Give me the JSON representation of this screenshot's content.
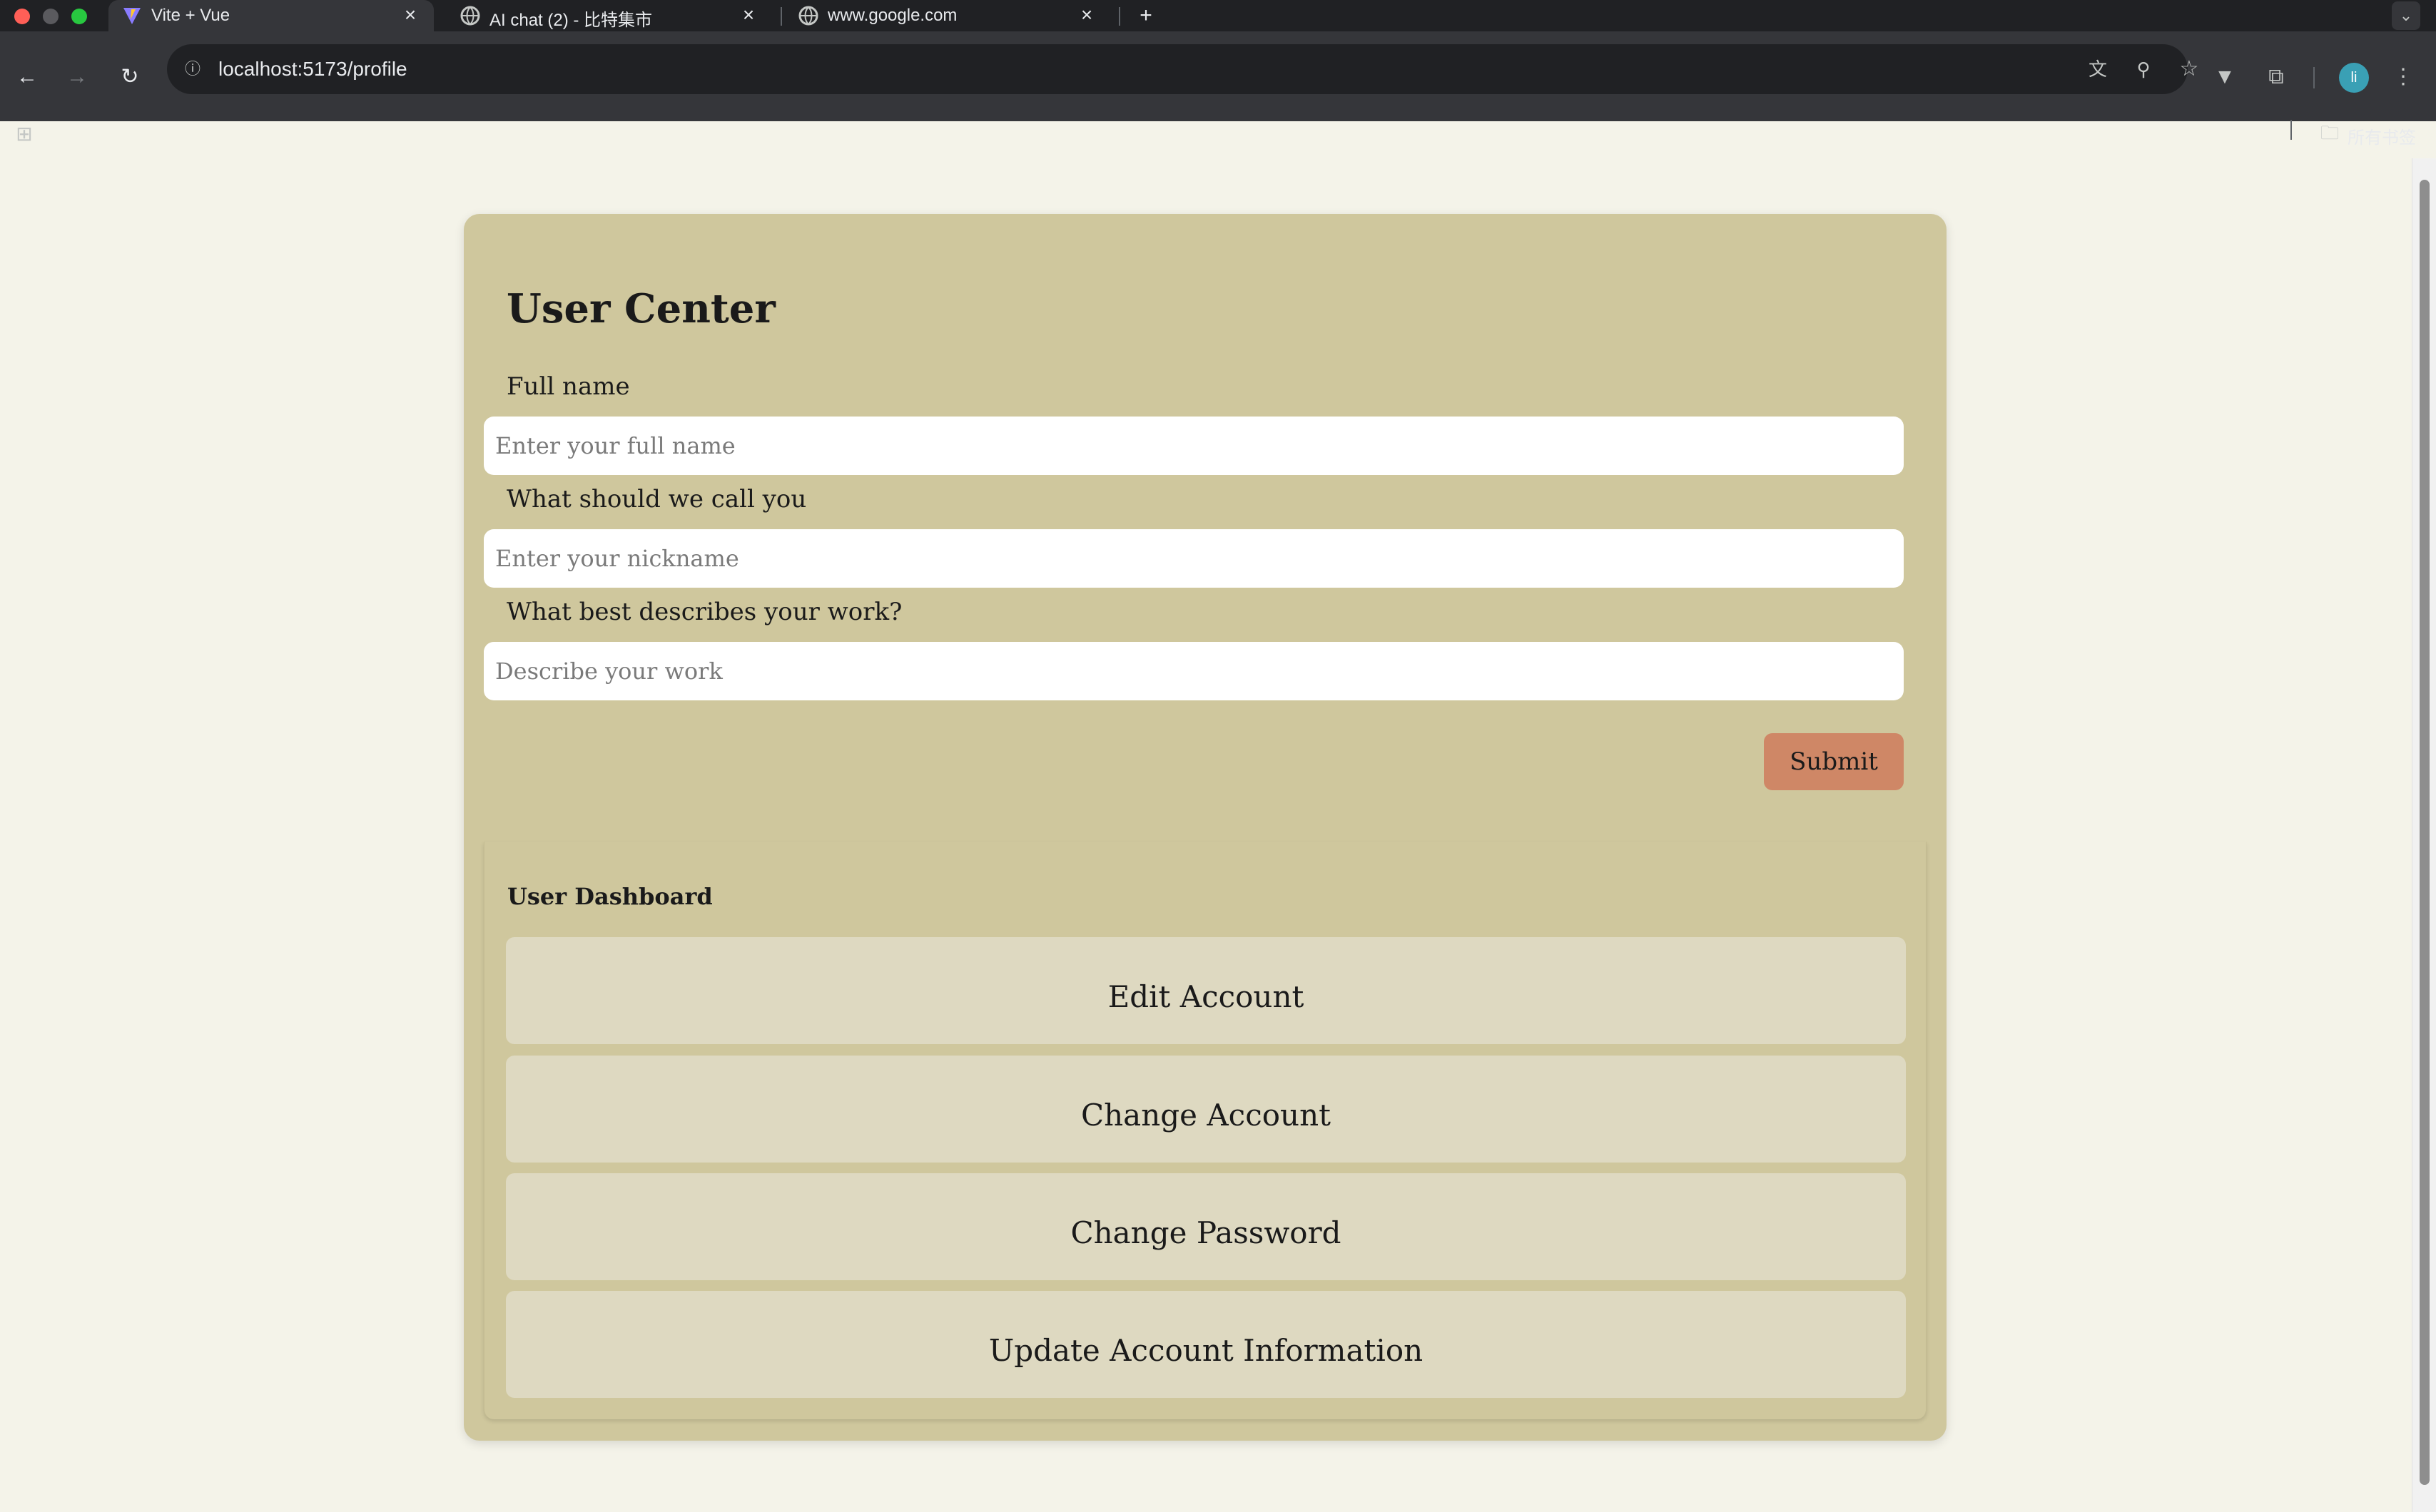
{
  "browser": {
    "tabs": [
      {
        "title": "Vite + Vue",
        "icon": "vite-icon",
        "active": true
      },
      {
        "title": "AI chat (2) - 比特集市",
        "icon": "globe-icon",
        "active": false
      },
      {
        "title": "www.google.com",
        "icon": "globe-icon",
        "active": false
      }
    ],
    "new_tab_symbol": "+",
    "url": "localhost:5173/profile",
    "profile_initial": "li",
    "bookmarks_folder": "所有书签"
  },
  "page": {
    "title": "User Center",
    "fields": [
      {
        "label": "Full name",
        "placeholder": "Enter your full name",
        "value": ""
      },
      {
        "label": "What should we call you",
        "placeholder": "Enter your nickname",
        "value": ""
      },
      {
        "label": "What best describes your work?",
        "placeholder": "Describe your work",
        "value": ""
      }
    ],
    "submit_label": "Submit",
    "dashboard": {
      "title": "User Dashboard",
      "buttons": [
        {
          "label": "Edit Account"
        },
        {
          "label": "Change Account"
        },
        {
          "label": "Change Password"
        },
        {
          "label": "Update Account Information"
        }
      ]
    }
  },
  "colors": {
    "page_background": "#f4f3e9",
    "card_background": "#cfc79d",
    "dashboard_button": "#ded9c1",
    "submit_button": "#cf8766"
  }
}
